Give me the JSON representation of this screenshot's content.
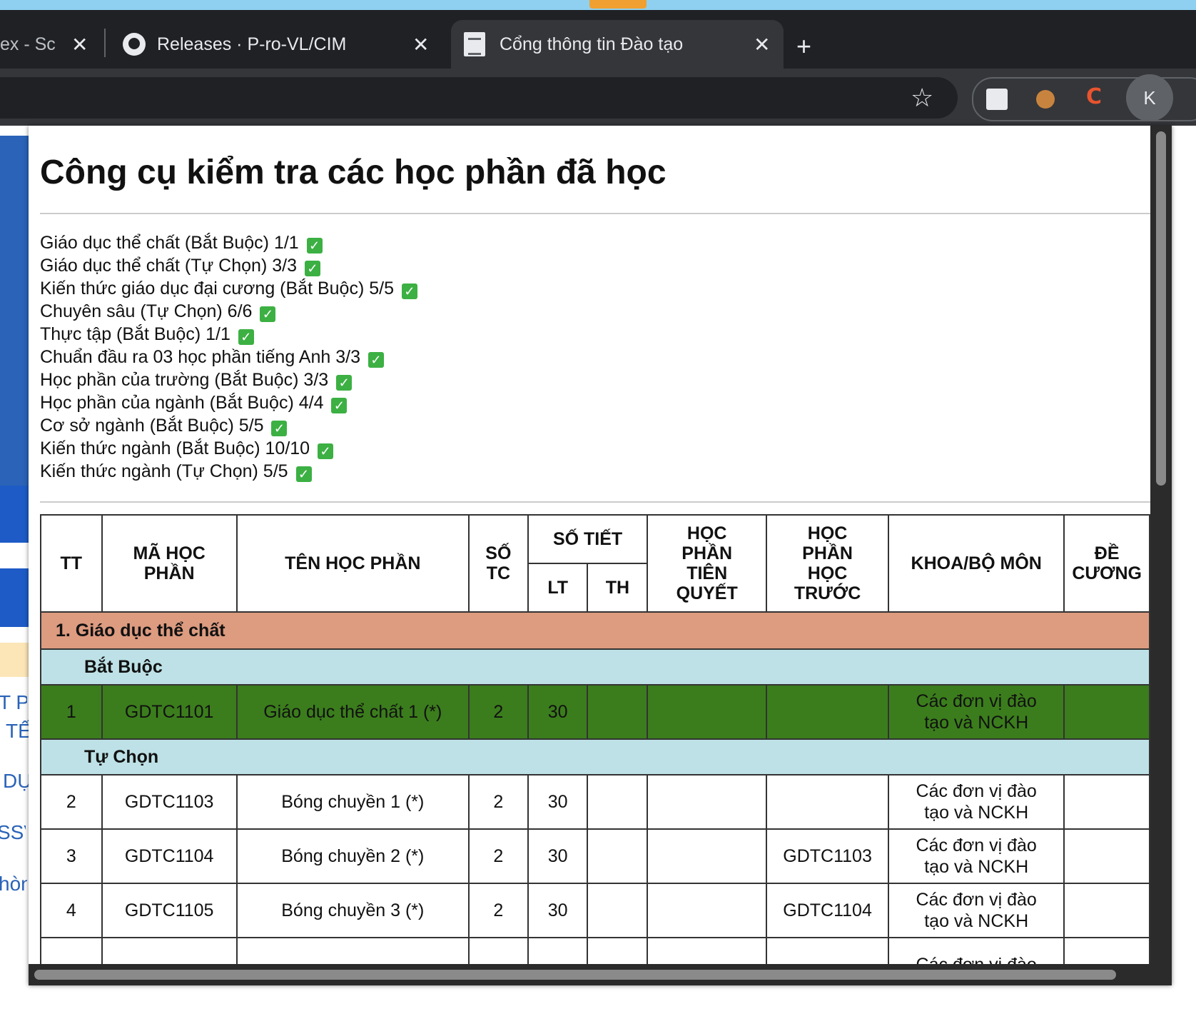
{
  "browser": {
    "tabs": [
      {
        "title": "ex - Sc",
        "active": false
      },
      {
        "title": "Releases · P-ro-VL/CIM",
        "active": false
      },
      {
        "title": "Cổng thông tin Đào tạo",
        "active": true
      }
    ],
    "profile_initial": "K"
  },
  "page": {
    "title": "Công cụ kiểm tra các học phần đã học",
    "summary": [
      "Giáo dục thể chất (Bắt Buộc) 1/1",
      "Giáo dục thể chất (Tự Chọn) 3/3",
      "Kiến thức giáo dục đại cương (Bắt Buộc) 5/5",
      "Chuyên sâu (Tự Chọn) 6/6",
      "Thực tập (Bắt Buộc) 1/1",
      "Chuẩn đầu ra 03 học phần tiếng Anh 3/3",
      "Học phần của trường (Bắt Buộc) 3/3",
      "Học phần của ngành (Bắt Buộc) 4/4",
      "Cơ sở ngành (Bắt Buộc) 5/5",
      "Kiến thức ngành (Bắt Buộc) 10/10",
      "Kiến thức ngành (Tự Chọn) 5/5"
    ],
    "check_mark": "✓"
  },
  "table": {
    "headers": {
      "tt": "TT",
      "ma": "MÃ HỌC PHẦN",
      "ten": "TÊN HỌC PHẦN",
      "sotc": "SỐ TC",
      "sotiet": "SỐ TIẾT",
      "lt": "LT",
      "th": "TH",
      "tienquyet": "HỌC PHẦN TIÊN QUYẾT",
      "hoctruoc": "HỌC PHẦN HỌC TRƯỚC",
      "khoa": "KHOA/BỘ MÔN",
      "decuong": "ĐỀ CƯƠNG"
    },
    "section": "1. Giáo dục thể chất",
    "groups": [
      "Bắt Buộc",
      "Tự Chọn"
    ],
    "rows": [
      {
        "tt": "1",
        "ma": "GDTC1101",
        "ten": "Giáo dục thể chất 1 (*)",
        "tc": "2",
        "lt": "30",
        "th": "",
        "tq": "",
        "ht": "",
        "khoa": "Các đơn vị đào tạo và NCKH",
        "completed": true
      },
      {
        "tt": "2",
        "ma": "GDTC1103",
        "ten": "Bóng chuyền 1 (*)",
        "tc": "2",
        "lt": "30",
        "th": "",
        "tq": "",
        "ht": "",
        "khoa": "Các đơn vị đào tạo và NCKH"
      },
      {
        "tt": "3",
        "ma": "GDTC1104",
        "ten": "Bóng chuyền 2 (*)",
        "tc": "2",
        "lt": "30",
        "th": "",
        "tq": "",
        "ht": "GDTC1103",
        "khoa": "Các đơn vị đào tạo và NCKH"
      },
      {
        "tt": "4",
        "ma": "GDTC1105",
        "ten": "Bóng chuyền 3 (*)",
        "tc": "2",
        "lt": "30",
        "th": "",
        "tq": "",
        "ht": "GDTC1104",
        "khoa": "Các đơn vị đào tạo và NCKH"
      },
      {
        "tt": "",
        "ma": "",
        "ten": "",
        "tc": "",
        "lt": "",
        "th": "",
        "tq": "",
        "ht": "",
        "khoa": "Các đơn vị đào"
      }
    ],
    "colors": {
      "section": "#dd9b80",
      "group": "#bde1e6",
      "completed": "#3b7d1c"
    }
  },
  "background_page": {
    "fragments": [
      "T P",
      "TẾ",
      "DỤ",
      "SSV",
      "hòn"
    ]
  }
}
